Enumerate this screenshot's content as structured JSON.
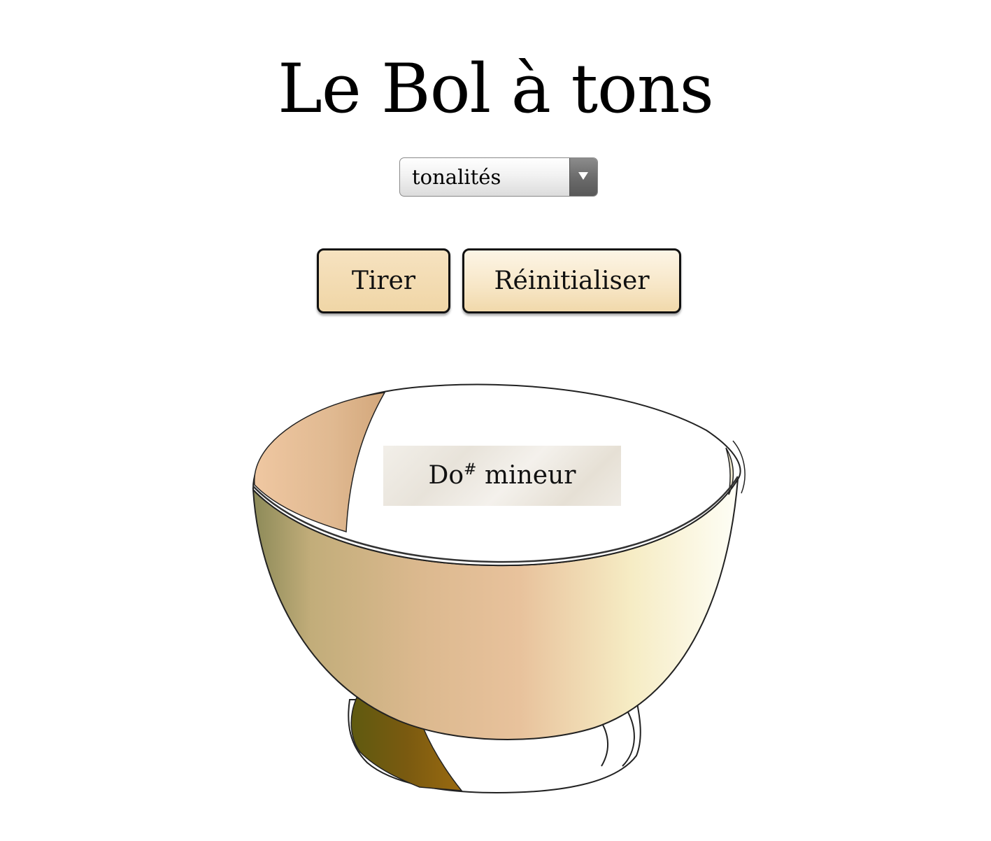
{
  "header": {
    "title": "Le Bol à tons"
  },
  "selector": {
    "selected_value": "tonalités"
  },
  "actions": {
    "draw_label": "Tirer",
    "reset_label": "Réinitialiser"
  },
  "result": {
    "note": "Do",
    "accidental": "#",
    "mode": "mineur"
  },
  "icons": {
    "bowl": "bowl-illustration",
    "dropdown": "chevron-down-icon"
  },
  "colors": {
    "button_fill": "#f5e1bd",
    "button_border": "#111111",
    "slip": "#ece8e0"
  }
}
